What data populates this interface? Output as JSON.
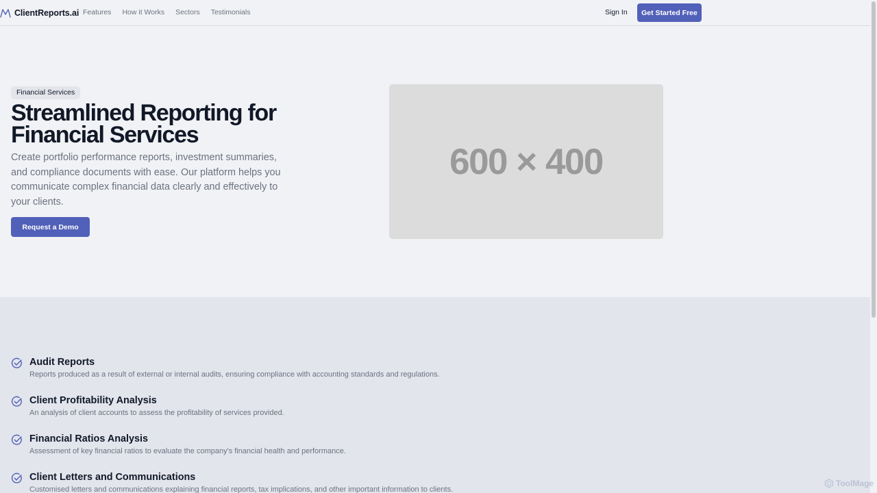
{
  "header": {
    "logo_text": "ClientReports.ai",
    "logo_icon": "mountain-logo-icon",
    "nav": [
      "Features",
      "How it Works",
      "Sectors",
      "Testimonials"
    ],
    "sign_in": "Sign In",
    "cta": "Get Started Free"
  },
  "hero": {
    "badge": "Financial Services",
    "title": "Streamlined Reporting for Financial Services",
    "description": "Create portfolio performance reports, investment summaries, and compliance documents with ease. Our platform helps you communicate complex financial data clearly and effectively to your clients.",
    "button": "Request a Demo",
    "image_placeholder": "600 × 400"
  },
  "features": [
    {
      "title": "Audit Reports",
      "description": "Reports produced as a result of external or internal audits, ensuring compliance with accounting standards and regulations."
    },
    {
      "title": "Client Profitability Analysis",
      "description": "An analysis of client accounts to assess the profitability of services provided."
    },
    {
      "title": "Financial Ratios Analysis",
      "description": "Assessment of key financial ratios to evaluate the company's financial health and performance."
    },
    {
      "title": "Client Letters and Communications",
      "description": "Customised letters and communications explaining financial reports, tax implications, and other important information to clients."
    }
  ],
  "watermark": "ToolMage",
  "colors": {
    "accent": "#5160b8",
    "background": "#f1f2f5",
    "section_background": "#e2e5ec",
    "placeholder": "#dcdcdc",
    "muted_text": "#6b7280"
  }
}
